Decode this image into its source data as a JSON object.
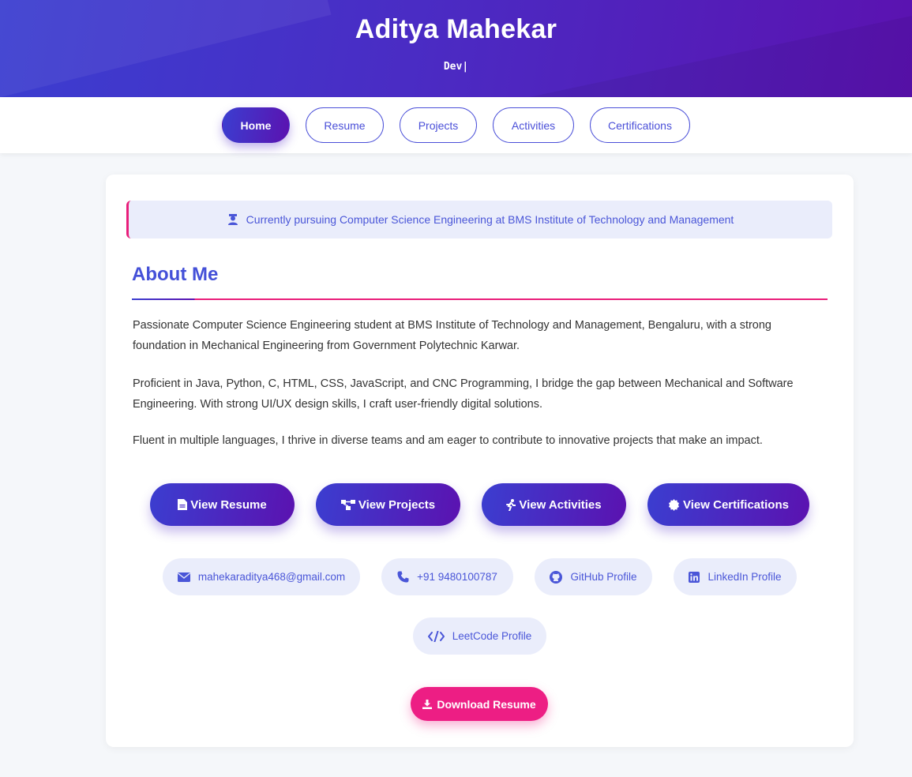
{
  "header": {
    "name": "Aditya Mahekar",
    "role": "Dev|"
  },
  "nav": {
    "items": [
      "Home",
      "Resume",
      "Projects",
      "Activities",
      "Certifications"
    ],
    "active": "Home"
  },
  "notice": {
    "icon": "graduate-icon",
    "text": "Currently pursuing Computer Science Engineering at BMS Institute of Technology and Management"
  },
  "about": {
    "title": "About Me",
    "paragraphs": [
      "Passionate Computer Science Engineering student at BMS Institute of Technology and Management, Bengaluru, with a strong foundation in Mechanical Engineering from Government Polytechnic Karwar.",
      "Proficient in Java, Python, C, HTML, CSS, JavaScript, and CNC Programming, I bridge the gap between Mechanical and Software Engineering. With strong UI/UX design skills, I craft user-friendly digital solutions.",
      "Fluent in multiple languages, I thrive in diverse teams and am eager to contribute to innovative projects that make an impact."
    ]
  },
  "actions": {
    "view_resume": "View Resume",
    "view_projects": "View Projects",
    "view_activities": "View Activities",
    "view_certifications": "View Certifications"
  },
  "contacts": {
    "email": "mahekaraditya468@gmail.com",
    "phone": "+91 9480100787",
    "github": "GitHub Profile",
    "linkedin": "LinkedIn Profile",
    "leetcode": "LeetCode Profile"
  },
  "download": {
    "label": "Download Resume"
  },
  "colors": {
    "gradient_start": "#3b3ed0",
    "gradient_end": "#5b12b0",
    "accent_pink": "#ed1e84",
    "link_blue": "#4a56d8",
    "pill_bg": "#eaedfb"
  }
}
